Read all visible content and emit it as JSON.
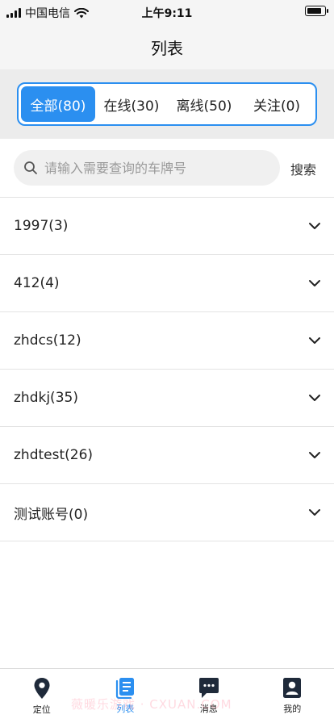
{
  "status_bar": {
    "carrier": "中国电信",
    "time": "上午9:11"
  },
  "nav": {
    "title": "列表"
  },
  "tabs": [
    {
      "label": "全部(80)",
      "active": true
    },
    {
      "label": "在线(30)",
      "active": false
    },
    {
      "label": "离线(50)",
      "active": false
    },
    {
      "label": "关注(0)",
      "active": false
    }
  ],
  "search": {
    "placeholder": "请输入需要查询的车牌号",
    "value": "",
    "button_label": "搜索"
  },
  "groups": [
    {
      "label": "1997(3)"
    },
    {
      "label": "412(4)"
    },
    {
      "label": "zhdcs(12)"
    },
    {
      "label": "zhdkj(35)"
    },
    {
      "label": "zhdtest(26)"
    },
    {
      "label": "测试账号(0)"
    }
  ],
  "tab_bar": {
    "items": [
      {
        "label": "定位",
        "icon": "location-pin-icon",
        "active": false
      },
      {
        "label": "列表",
        "icon": "list-document-icon",
        "active": true
      },
      {
        "label": "消息",
        "icon": "message-icon",
        "active": false
      },
      {
        "label": "我的",
        "icon": "profile-icon",
        "active": false
      }
    ]
  },
  "watermark": "薇暖乐游戏 · CXUAN.COM",
  "colors": {
    "accent": "#2b8ff0",
    "icon_dark": "#1f2a3a",
    "background_gray": "#ececec"
  }
}
